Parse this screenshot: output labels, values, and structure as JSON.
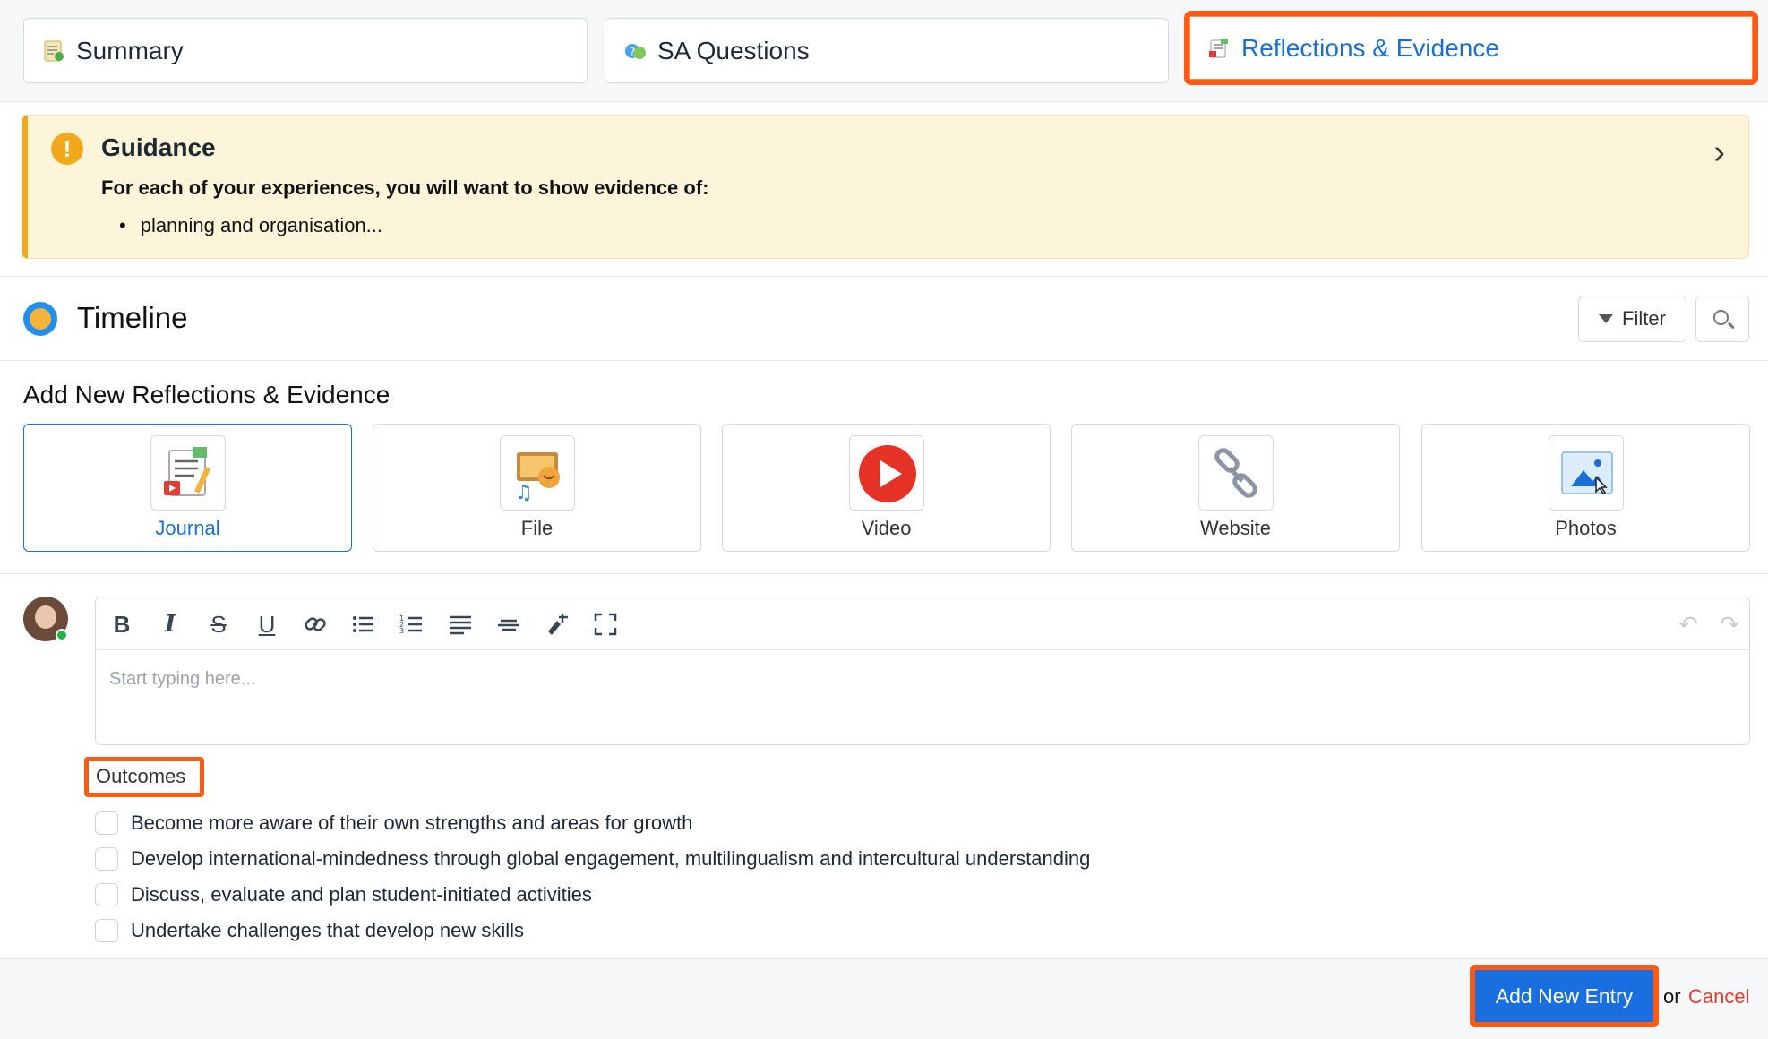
{
  "tabs": [
    {
      "label": "Summary",
      "icon": "summary-icon"
    },
    {
      "label": "SA Questions",
      "icon": "questions-icon"
    },
    {
      "label": "Reflections & Evidence",
      "icon": "reflections-icon",
      "active": true
    }
  ],
  "guidance": {
    "title": "Guidance",
    "body": "For each of your experiences, you will want to show evidence of:",
    "items": [
      "planning and organisation..."
    ]
  },
  "timeline": {
    "title": "Timeline",
    "filter_label": "Filter"
  },
  "add_new": {
    "title": "Add New Reflections & Evidence",
    "types": [
      {
        "label": "Journal",
        "icon": "journal-icon",
        "selected": true
      },
      {
        "label": "File",
        "icon": "file-icon"
      },
      {
        "label": "Video",
        "icon": "video-icon"
      },
      {
        "label": "Website",
        "icon": "website-link-icon"
      },
      {
        "label": "Photos",
        "icon": "photos-icon"
      }
    ]
  },
  "editor": {
    "placeholder": "Start typing here..."
  },
  "outcomes": {
    "label": "Outcomes",
    "items": [
      "Become more aware of their own strengths and areas for growth",
      "Develop international-mindedness through global engagement, multilingualism and intercultural understanding",
      "Discuss, evaluate and plan student-initiated activities",
      "Undertake challenges that develop new skills"
    ]
  },
  "footer": {
    "add_label": "Add New Entry",
    "or_label": "or",
    "cancel_label": "Cancel"
  },
  "colors": {
    "accent": "#1a6fd6",
    "highlight": "#ff5a14",
    "warning": "#f2a81d",
    "cancel": "#e03b2d"
  }
}
